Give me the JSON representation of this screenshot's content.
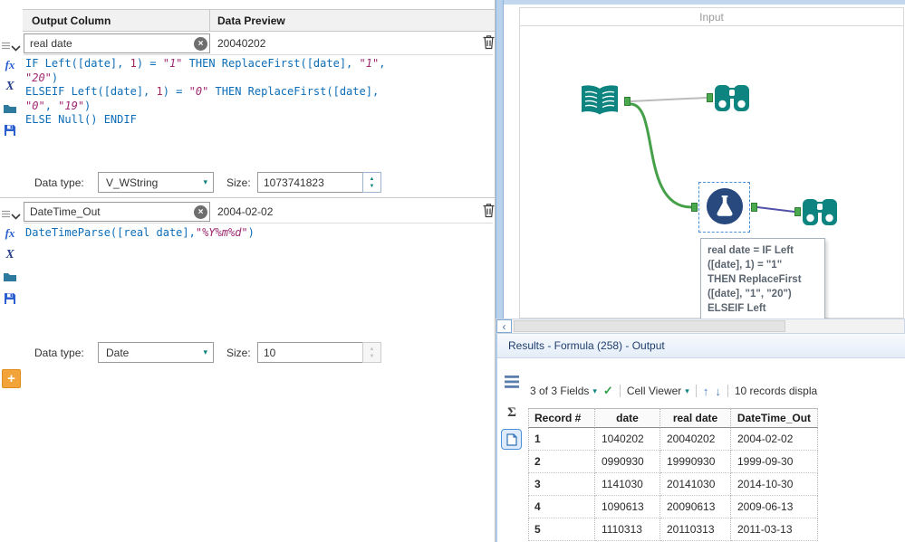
{
  "formula_panel": {
    "header": {
      "output_column": "Output Column",
      "data_preview": "Data Preview"
    },
    "expressions": [
      {
        "name": "real date",
        "preview": "20040202",
        "code": [
          [
            [
              "k",
              "IF Left([date], "
            ],
            [
              "n",
              "1"
            ],
            [
              "k",
              ") = "
            ],
            [
              "s",
              "\"1\""
            ],
            [
              "k",
              " THEN ReplaceFirst([date], "
            ],
            [
              "s",
              "\"1\""
            ],
            [
              "k",
              ","
            ]
          ],
          [
            [
              "s",
              "\"20\""
            ],
            [
              "k",
              ")"
            ]
          ],
          [
            [
              "k",
              "ELSEIF Left([date], "
            ],
            [
              "n",
              "1"
            ],
            [
              "k",
              ") = "
            ],
            [
              "s",
              "\"0\""
            ],
            [
              "k",
              " THEN ReplaceFirst([date],"
            ]
          ],
          [
            [
              "s",
              "\"0\""
            ],
            [
              "k",
              ", "
            ],
            [
              "s",
              "\"19\""
            ],
            [
              "k",
              ")"
            ]
          ],
          [
            [
              "k",
              "ELSE Null() ENDIF"
            ]
          ]
        ],
        "data_type_label": "Data type:",
        "data_type": "V_WString",
        "size_label": "Size:",
        "size": "1073741823"
      },
      {
        "name": "DateTime_Out",
        "preview": "2004-02-02",
        "code": [
          [
            [
              "k",
              "DateTimeParse([real date],"
            ],
            [
              "s",
              "\"%Y%m%d\""
            ],
            [
              "k",
              ")"
            ]
          ]
        ],
        "data_type_label": "Data type:",
        "data_type": "Date",
        "size_label": "Size:",
        "size": "10"
      }
    ],
    "add_label": "+"
  },
  "canvas": {
    "container_label": "Input",
    "annotation_lines": [
      "real date = IF Left",
      "([date], 1) = \"1\"",
      "THEN ReplaceFirst",
      "([date], \"1\", \"20\")",
      "ELSEIF Left"
    ]
  },
  "results_panel": {
    "title": "Results - Formula (258) - Output",
    "toolbar": {
      "fields": "3 of 3 Fields",
      "cell_viewer": "Cell Viewer",
      "records": "10 records displa"
    },
    "table": {
      "headers": [
        "Record #",
        "date",
        "real date",
        "DateTime_Out"
      ],
      "rows": [
        [
          "1",
          "1040202",
          "20040202",
          "2004-02-02"
        ],
        [
          "2",
          "0990930",
          "19990930",
          "1999-09-30"
        ],
        [
          "3",
          "1141030",
          "20141030",
          "2014-10-30"
        ],
        [
          "4",
          "1090613",
          "20090613",
          "2009-06-13"
        ],
        [
          "5",
          "1110313",
          "20110313",
          "2011-03-13"
        ]
      ]
    }
  },
  "icons": {
    "caret": "▾",
    "check": "✓",
    "up_arrow": "↑",
    "down_arrow": "↓",
    "scroll_left": "‹",
    "clear": "×",
    "spinner_up": "▲",
    "spinner_down": "▼",
    "fx": "fx",
    "variable_x": "X",
    "sigma": "Σ"
  }
}
